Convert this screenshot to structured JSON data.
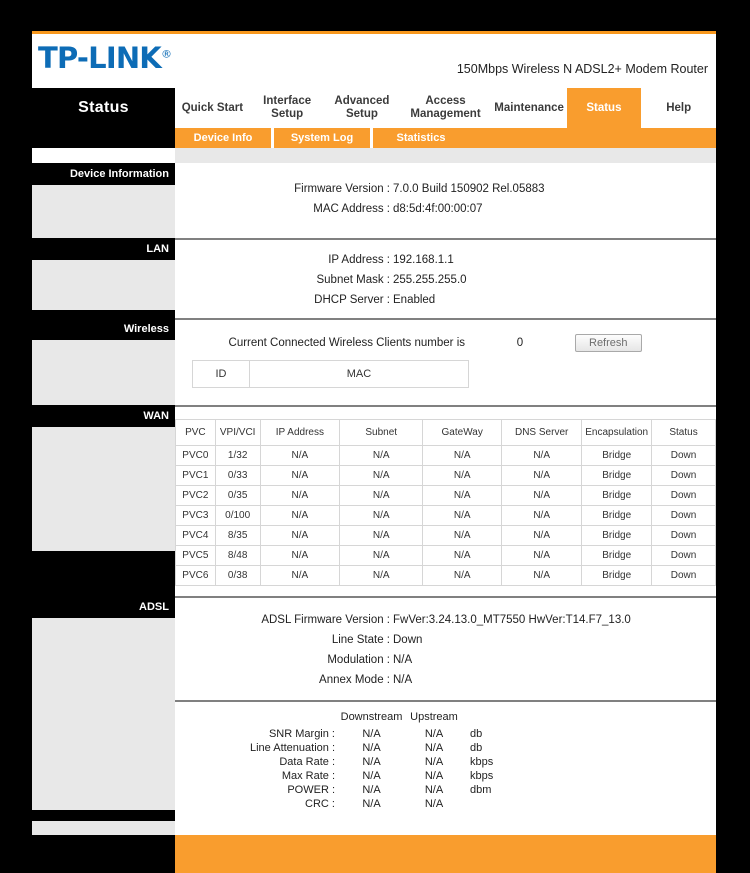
{
  "header": {
    "logo_text": "TP-LINK",
    "logo_reg": "®",
    "model": "150Mbps Wireless N ADSL2+ Modem Router",
    "page_title": "Status"
  },
  "nav": {
    "tabs": [
      {
        "label": "Quick Start",
        "active": false
      },
      {
        "label": "Interface Setup",
        "active": false
      },
      {
        "label": "Advanced Setup",
        "active": false
      },
      {
        "label": "Access Management",
        "active": false
      },
      {
        "label": "Maintenance",
        "active": false
      },
      {
        "label": "Status",
        "active": true
      },
      {
        "label": "Help",
        "active": false
      }
    ],
    "subtabs": [
      "Device Info",
      "System Log",
      "Statistics"
    ]
  },
  "sections": {
    "device_information": {
      "label": "Device Information",
      "rows": [
        {
          "label": "Firmware Version :",
          "value": "7.0.0 Build 150902 Rel.05883"
        },
        {
          "label": "MAC Address :",
          "value": "d8:5d:4f:00:00:07"
        }
      ]
    },
    "lan": {
      "label": "LAN",
      "rows": [
        {
          "label": "IP Address :",
          "value": "192.168.1.1"
        },
        {
          "label": "Subnet Mask :",
          "value": "255.255.255.0"
        },
        {
          "label": "DHCP Server :",
          "value": "Enabled"
        }
      ]
    },
    "wireless": {
      "label": "Wireless",
      "clients_text": "Current Connected Wireless Clients number is",
      "clients_count": "0",
      "refresh_label": "Refresh",
      "table_headers": [
        "ID",
        "MAC"
      ]
    },
    "wan": {
      "label": "WAN",
      "headers": [
        "PVC",
        "VPI/VCI",
        "IP Address",
        "Subnet",
        "GateWay",
        "DNS Server",
        "Encapsulation",
        "Status"
      ],
      "rows": [
        [
          "PVC0",
          "1/32",
          "N/A",
          "N/A",
          "N/A",
          "N/A",
          "Bridge",
          "Down"
        ],
        [
          "PVC1",
          "0/33",
          "N/A",
          "N/A",
          "N/A",
          "N/A",
          "Bridge",
          "Down"
        ],
        [
          "PVC2",
          "0/35",
          "N/A",
          "N/A",
          "N/A",
          "N/A",
          "Bridge",
          "Down"
        ],
        [
          "PVC3",
          "0/100",
          "N/A",
          "N/A",
          "N/A",
          "N/A",
          "Bridge",
          "Down"
        ],
        [
          "PVC4",
          "8/35",
          "N/A",
          "N/A",
          "N/A",
          "N/A",
          "Bridge",
          "Down"
        ],
        [
          "PVC5",
          "8/48",
          "N/A",
          "N/A",
          "N/A",
          "N/A",
          "Bridge",
          "Down"
        ],
        [
          "PVC6",
          "0/38",
          "N/A",
          "N/A",
          "N/A",
          "N/A",
          "Bridge",
          "Down"
        ]
      ]
    },
    "adsl": {
      "label": "ADSL",
      "rows": [
        {
          "label": "ADSL Firmware Version :",
          "value": "FwVer:3.24.13.0_MT7550 HwVer:T14.F7_13.0"
        },
        {
          "label": "Line State :",
          "value": "Down"
        },
        {
          "label": "Modulation :",
          "value": "N/A"
        },
        {
          "label": "Annex Mode :",
          "value": "N/A"
        }
      ],
      "stats_headers": {
        "downstream": "Downstream",
        "upstream": "Upstream"
      },
      "stats": [
        {
          "label": "SNR Margin :",
          "down": "N/A",
          "up": "N/A",
          "unit": "db"
        },
        {
          "label": "Line Attenuation :",
          "down": "N/A",
          "up": "N/A",
          "unit": "db"
        },
        {
          "label": "Data Rate :",
          "down": "N/A",
          "up": "N/A",
          "unit": "kbps"
        },
        {
          "label": "Max Rate :",
          "down": "N/A",
          "up": "N/A",
          "unit": "kbps"
        },
        {
          "label": "POWER :",
          "down": "N/A",
          "up": "N/A",
          "unit": "dbm"
        },
        {
          "label": "CRC :",
          "down": "N/A",
          "up": "N/A",
          "unit": ""
        }
      ]
    }
  },
  "colors": {
    "accent_orange": "#f99d2e",
    "rule_orange": "#f8981d",
    "brand_blue": "#0d6cb6",
    "panel_gray": "#e8e8e8",
    "divider_gray": "#808080"
  }
}
